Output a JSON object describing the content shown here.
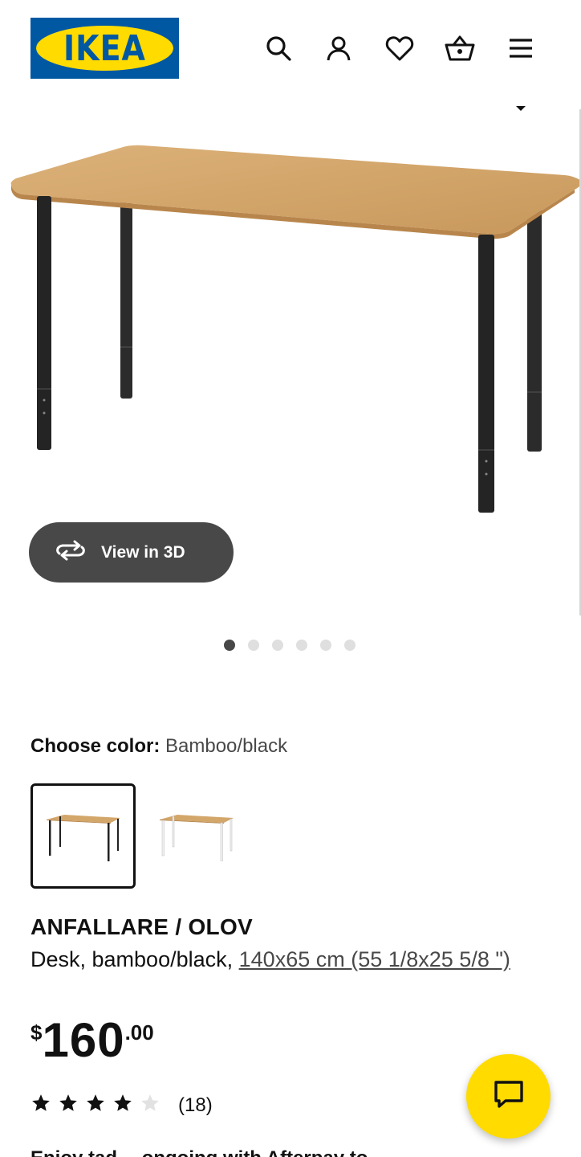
{
  "header": {
    "logo_text": "IKEA",
    "icons": [
      "search-icon",
      "account-icon",
      "heart-icon",
      "basket-icon",
      "menu-icon"
    ]
  },
  "gallery": {
    "view_3d_label": "View in 3D",
    "dot_count": 6,
    "active_dot": 1
  },
  "color": {
    "label": "Choose color:",
    "selected": "Bamboo/black",
    "options": [
      "Bamboo/black",
      "Bamboo/white"
    ]
  },
  "product": {
    "name": "ANFALLARE / OLOV",
    "description": "Desk, bamboo/black,",
    "dimensions": "140x65 cm (55 1/8x25 5/8 \")"
  },
  "price": {
    "currency": "$",
    "integer": "160",
    "decimal": ".00"
  },
  "rating": {
    "stars": 4,
    "max": 5,
    "count": "(18)"
  },
  "cutoff_text": "Enjoy tad… ongoing with Afterpay to…",
  "colors": {
    "brand_blue": "#0058a3",
    "brand_yellow": "#ffdb00",
    "dark_button": "#484848"
  }
}
